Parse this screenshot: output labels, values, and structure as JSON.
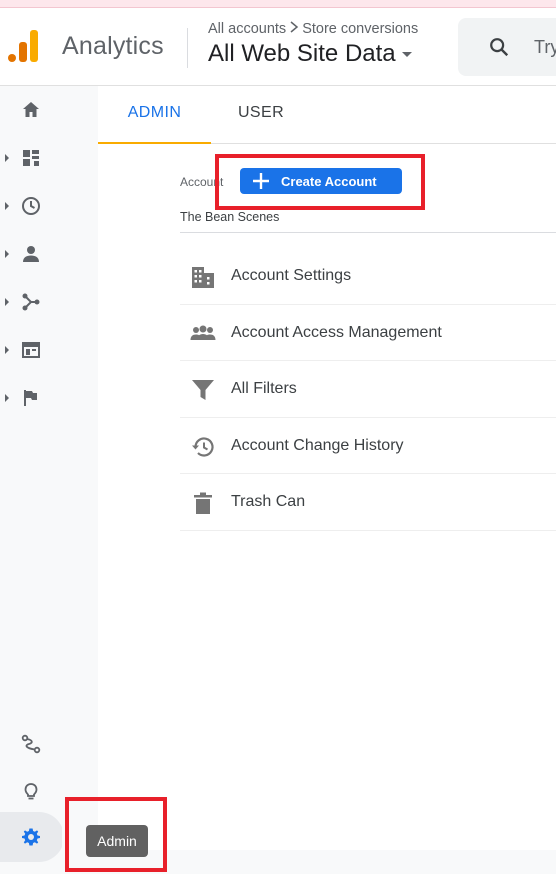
{
  "app": {
    "name": "Analytics"
  },
  "breadcrumb": {
    "accounts": "All accounts",
    "conversions": "Store conversions"
  },
  "property": {
    "name": "All Web Site Data"
  },
  "search": {
    "placeholder": "Try"
  },
  "tabs": [
    {
      "label": "ADMIN",
      "active": true
    },
    {
      "label": "USER",
      "active": false
    }
  ],
  "account": {
    "label": "Account",
    "create_label": "Create Account",
    "name": "The Bean Scenes"
  },
  "menu": [
    {
      "label": "Account Settings",
      "icon": "building-icon"
    },
    {
      "label": "Account Access Management",
      "icon": "people-icon"
    },
    {
      "label": "All Filters",
      "icon": "filter-icon"
    },
    {
      "label": "Account Change History",
      "icon": "history-icon"
    },
    {
      "label": "Trash Can",
      "icon": "trash-icon"
    }
  ],
  "rail": [
    {
      "icon": "home-icon",
      "expandable": false
    },
    {
      "icon": "dashboard-icon",
      "expandable": true
    },
    {
      "icon": "clock-icon",
      "expandable": true
    },
    {
      "icon": "person-icon",
      "expandable": true
    },
    {
      "icon": "acquisition-icon",
      "expandable": true
    },
    {
      "icon": "behavior-icon",
      "expandable": true
    },
    {
      "icon": "flag-icon",
      "expandable": true
    },
    {
      "icon": "attribution-icon",
      "expandable": false
    },
    {
      "icon": "lightbulb-icon",
      "expandable": false
    },
    {
      "icon": "gear-icon",
      "expandable": false
    }
  ],
  "tooltip": {
    "admin": "Admin"
  },
  "colors": {
    "accent": "#1a73e8",
    "tab_underline": "#f9ab00",
    "highlight": "#e8202a"
  }
}
